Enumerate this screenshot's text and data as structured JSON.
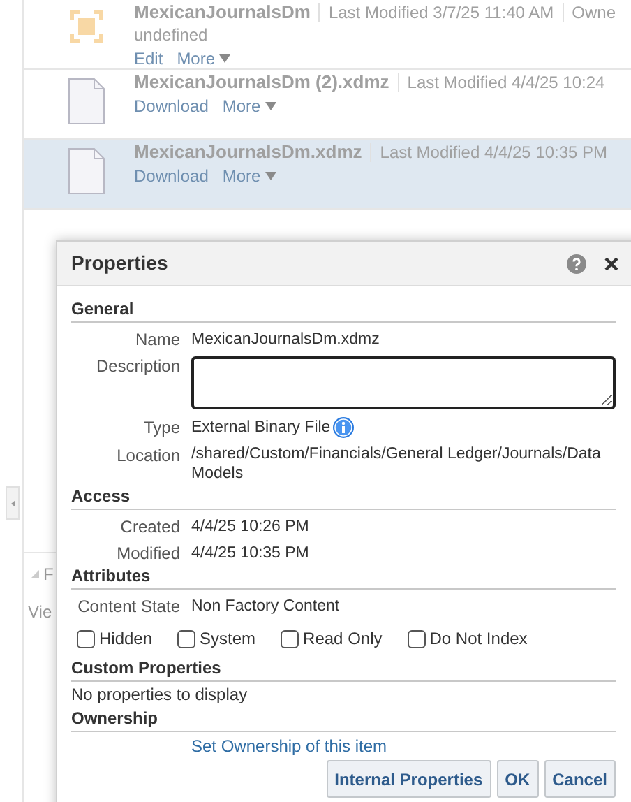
{
  "list_items": [
    {
      "kind": "data_model",
      "name": "MexicanJournalsDm",
      "modified": "Last Modified 3/7/25 11:40 AM",
      "owner": "Owne",
      "description": "undefined",
      "actions": [
        "Edit",
        "More"
      ],
      "selected": false
    },
    {
      "kind": "file",
      "name": "MexicanJournalsDm (2).xdmz",
      "modified": "Last Modified 4/4/25 10:24",
      "actions": [
        "Download",
        "More"
      ],
      "selected": false
    },
    {
      "kind": "file",
      "name": "MexicanJournalsDm.xdmz",
      "modified": "Last Modified 4/4/25 10:35 PM",
      "actions": [
        "Download",
        "More"
      ],
      "selected": true
    }
  ],
  "side_panel": {
    "heading": "F",
    "text": "Vie"
  },
  "dialog": {
    "title": "Properties",
    "sections": [
      {
        "title": "General",
        "fields": [
          {
            "kind": "text",
            "label": "Name",
            "value": "MexicanJournalsDm.xdmz"
          },
          {
            "kind": "textarea",
            "label": "Description"
          },
          {
            "kind": "info",
            "label": "Type",
            "value": "External Binary File"
          },
          {
            "kind": "text",
            "label": "Location",
            "value": "/shared/Custom/Financials/General Ledger/Journals/Data Models"
          }
        ]
      },
      {
        "title": "Access",
        "fields": [
          {
            "kind": "text",
            "label": "Created",
            "value": "4/4/25 10:26 PM"
          },
          {
            "kind": "text",
            "label": "Modified",
            "value": "4/4/25 10:35 PM"
          }
        ]
      },
      {
        "title": "Attributes",
        "fields": [
          {
            "kind": "text",
            "label": "Content State",
            "value": "Non Factory Content"
          }
        ],
        "checkboxes": [
          {
            "label": "Hidden",
            "checked": false
          },
          {
            "label": "System",
            "checked": false
          },
          {
            "label": "Read Only",
            "checked": false
          },
          {
            "label": "Do Not Index",
            "checked": false
          }
        ]
      },
      {
        "title": "Custom Properties",
        "note": "No properties to display"
      },
      {
        "title": "Ownership",
        "link": "Set Ownership of this item"
      }
    ],
    "buttons": [
      "Internal Properties",
      "OK",
      "Cancel"
    ]
  }
}
